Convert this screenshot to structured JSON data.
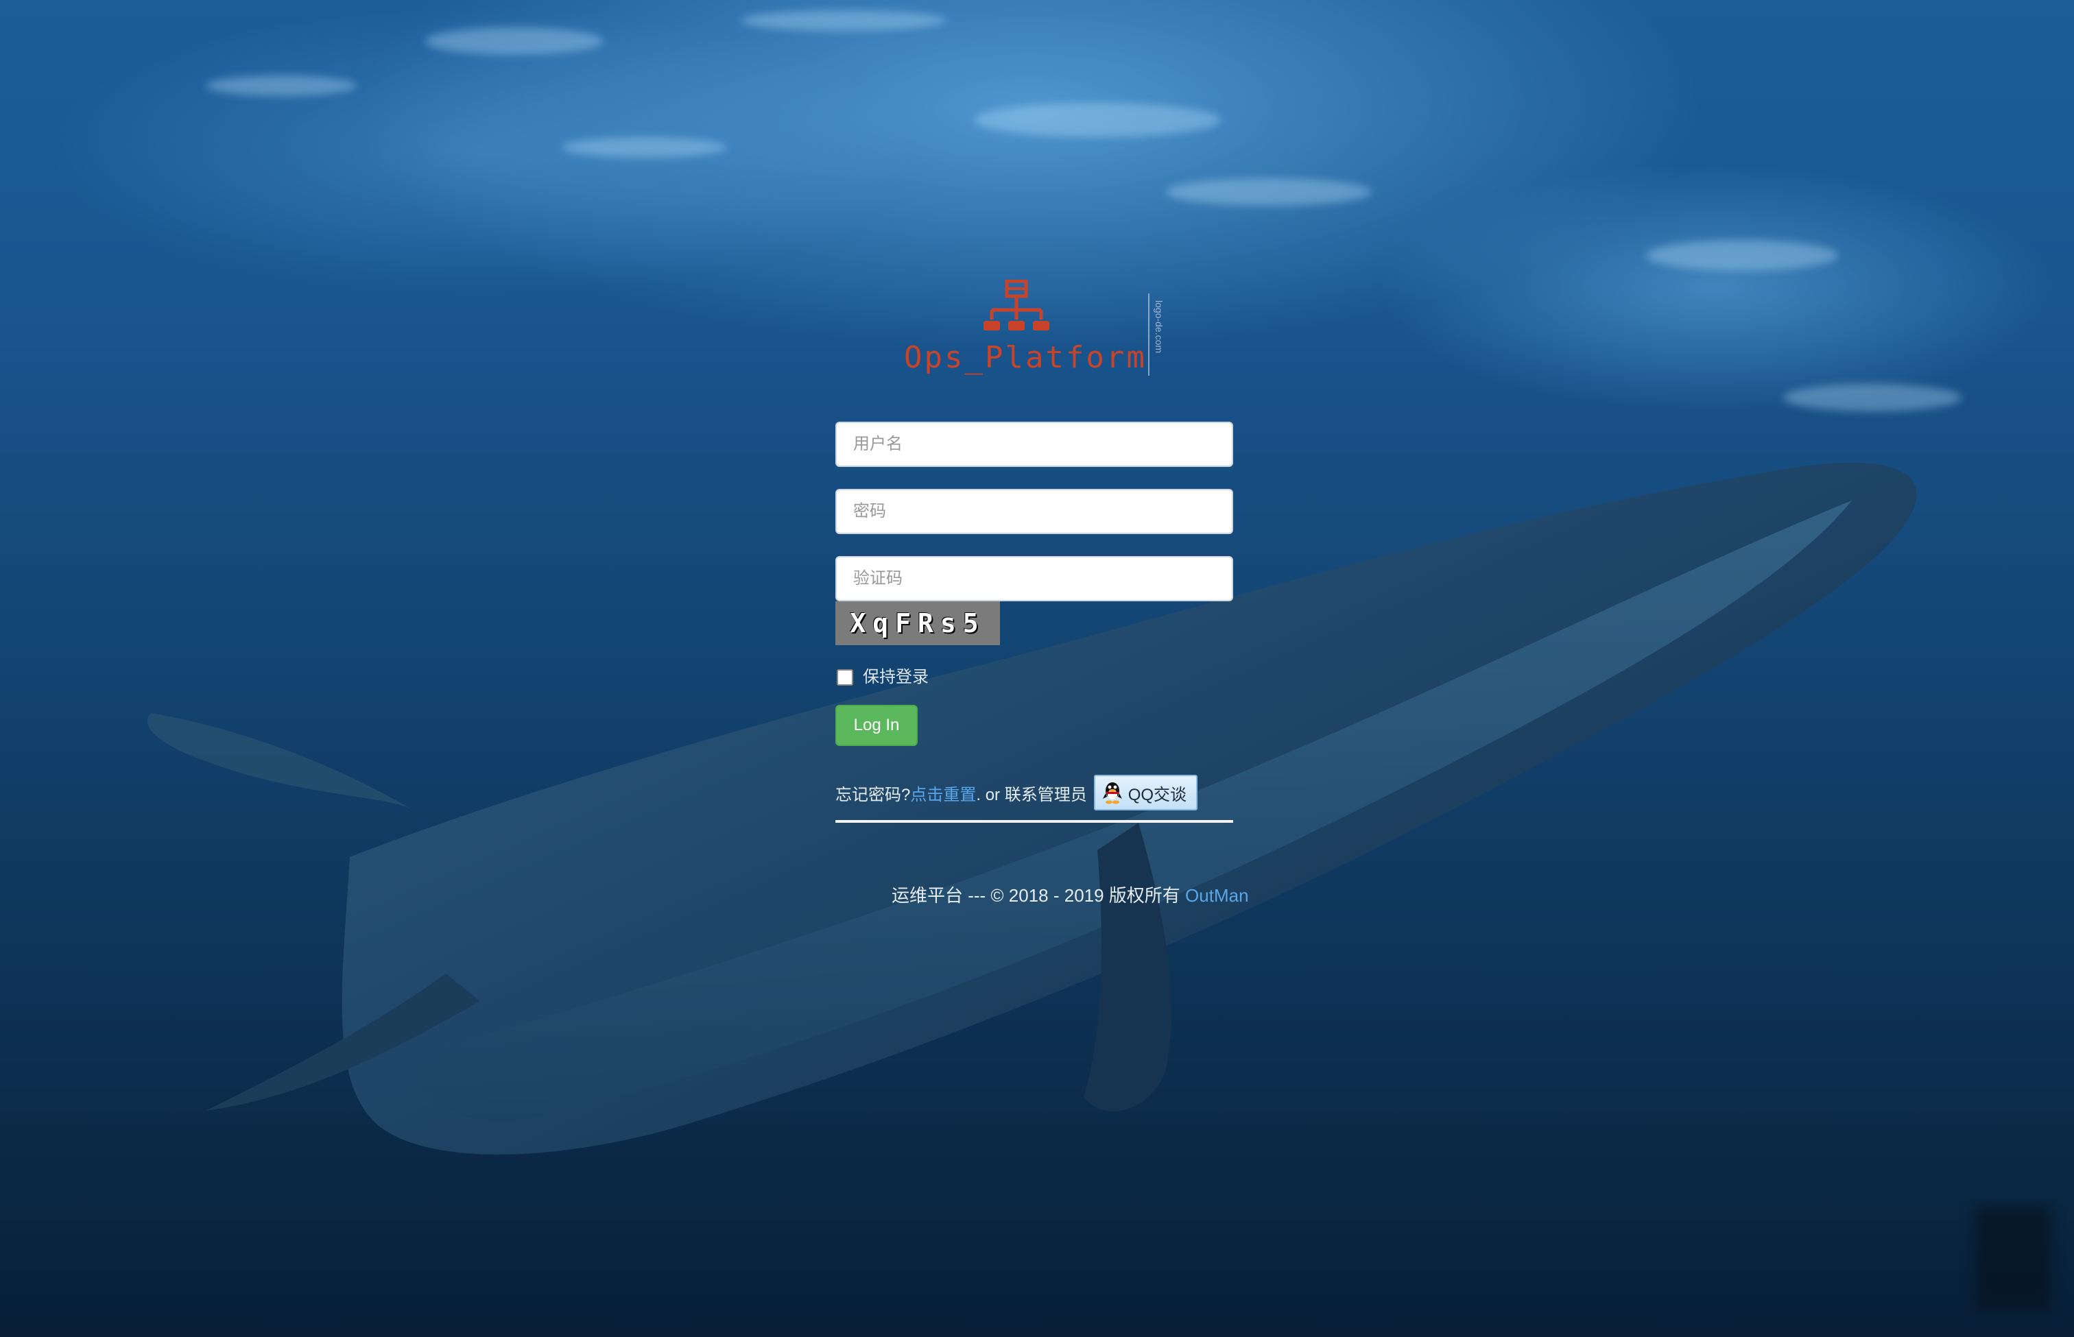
{
  "logo": {
    "text": "Ops_Platform",
    "side_text": "logo-de.com",
    "color": "#c8432a",
    "icon": "network-hierarchy-icon"
  },
  "form": {
    "username": {
      "placeholder": "用户名",
      "value": ""
    },
    "password": {
      "placeholder": "密码",
      "value": ""
    },
    "captcha": {
      "placeholder": "验证码",
      "value": ""
    },
    "captcha_image_text": "XqFRs5",
    "remember_label": "保持登录",
    "remember_checked": false,
    "login_button": "Log In",
    "login_button_color": "#5cb85c"
  },
  "help": {
    "forgot_prefix": "忘记密码?",
    "reset_link": "点击重置",
    "middle_text": ". or 联系管理员",
    "qq_button": "QQ交谈",
    "qq_icon": "qq-penguin-icon",
    "link_color": "#5aa6e8"
  },
  "footer": {
    "text": "运维平台 --- © 2018 - 2019 版权所有 ",
    "author_link": "OutMan"
  }
}
